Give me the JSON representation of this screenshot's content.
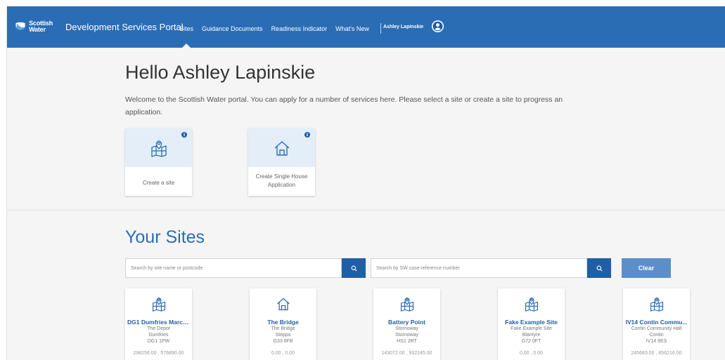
{
  "header": {
    "logo_text_1": "Scottish",
    "logo_text_2": "Water",
    "portal_title": "Development Services Portal",
    "nav": [
      "Sites",
      "Guidance Documents",
      "Readiness Indicator",
      "What's New"
    ],
    "user_name": "Ashley Lapinskie",
    "brand_color": "#2a6db5"
  },
  "hero": {
    "greeting": "Hello Ashley Lapinskie",
    "welcome": "Welcome to the Scottish Water portal. You can apply for a number of services here. Please select a site or create a site to progress an application.",
    "actions": [
      {
        "label": "Create a site",
        "icon": "site-map-icon"
      },
      {
        "label": "Create Single House Application",
        "icon": "house-icon"
      }
    ]
  },
  "sites": {
    "title": "Your Sites",
    "search_name_placeholder": "Search by site name or postcode",
    "search_ref_placeholder": "Search by SW case reference number",
    "clear_label": "Clear",
    "items": [
      {
        "name": "DG1 Dumfries March...",
        "line1": "The Depot",
        "line2": "Dumfries",
        "line3": "DG1 1PW",
        "coords": "298256.00 , 576890.00",
        "icon": "site-map-icon"
      },
      {
        "name": "The Bridge",
        "line1": "The Bridge",
        "line2": "Stepps",
        "line3": "G33 6FB",
        "coords": "0.00 , 0.00",
        "icon": "house-icon"
      },
      {
        "name": "Battery Point",
        "line1": "Stornoway",
        "line2": "Stornoway",
        "line3": "HS1 2RT",
        "coords": "143072.00 , 932245.00",
        "icon": "site-map-icon"
      },
      {
        "name": "Fake Example Site",
        "line1": "Fake Example Site",
        "line2": "Blantyre",
        "line3": "G72 0FT",
        "coords": "0.00 , 0.00",
        "icon": "site-map-icon"
      },
      {
        "name": "IV14 Contin Commu...",
        "line1": "Contin Community Hall",
        "line2": "Contin",
        "line3": "IV14 9ES",
        "coords": "245683.00 , 856216.00",
        "icon": "site-map-icon"
      }
    ]
  }
}
